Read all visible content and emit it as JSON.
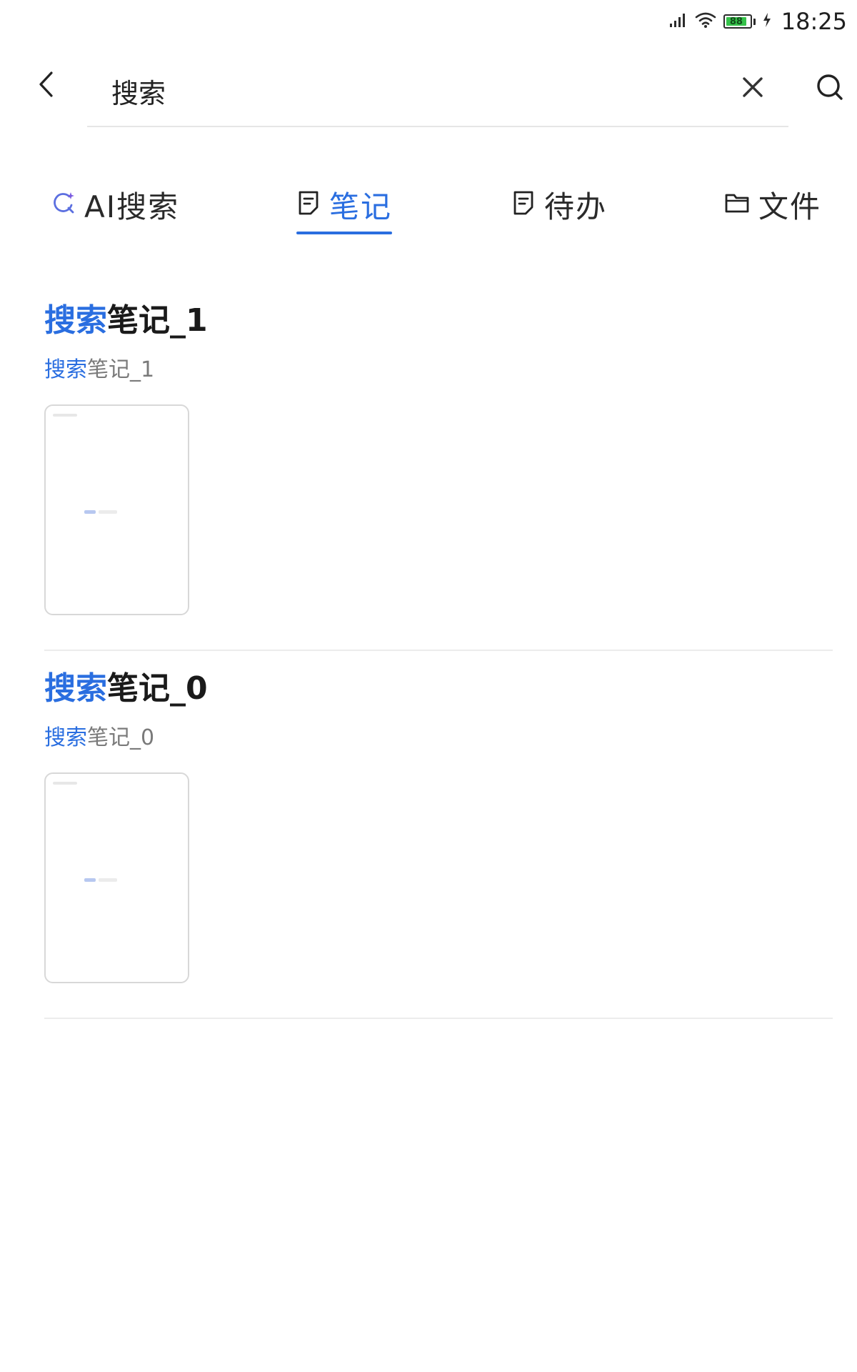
{
  "status_bar": {
    "time": "18:25",
    "battery_level": "88",
    "icons": [
      "signal-icon",
      "wifi-icon",
      "battery-icon",
      "charging-icon"
    ]
  },
  "search": {
    "query": "搜索",
    "icons": [
      "back-arrow-icon",
      "clear-icon",
      "search-icon"
    ]
  },
  "tabs": [
    {
      "label": "AI搜索",
      "icon": "ai-search-icon",
      "active": false
    },
    {
      "label": "笔记",
      "icon": "note-icon",
      "active": true
    },
    {
      "label": "待办",
      "icon": "todo-icon",
      "active": false
    },
    {
      "label": "文件",
      "icon": "folder-icon",
      "active": false
    }
  ],
  "results": [
    {
      "title_highlight": "搜索",
      "title_rest": "笔记_1",
      "snippet_highlight": "搜索",
      "snippet_rest": "笔记_1"
    },
    {
      "title_highlight": "搜索",
      "title_rest": "笔记_0",
      "snippet_highlight": "搜索",
      "snippet_rest": "笔记_0"
    }
  ],
  "colors": {
    "accent": "#2a6ee0",
    "text": "#1a1a1a",
    "muted": "#7a7a7a",
    "divider": "#ececec",
    "battery": "#35c24a"
  }
}
